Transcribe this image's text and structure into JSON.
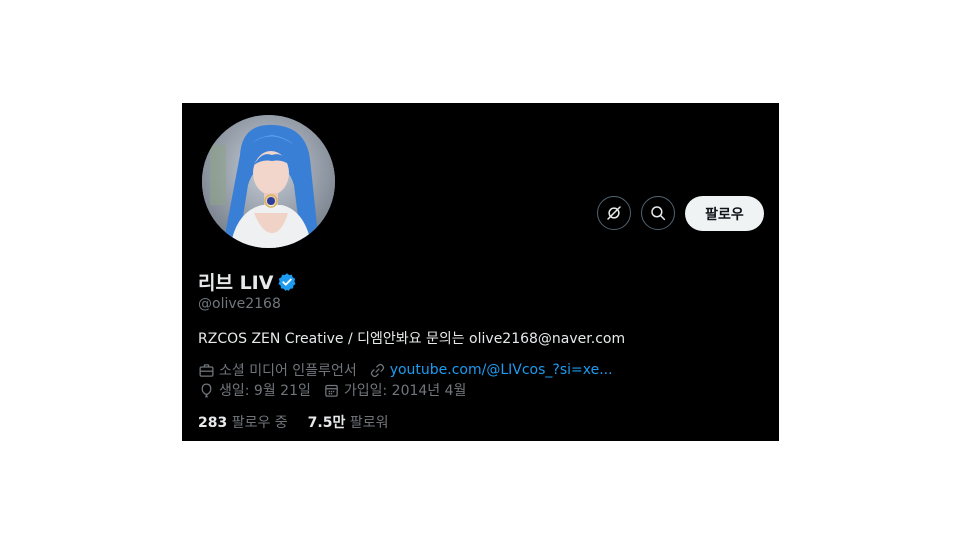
{
  "profile": {
    "name": "리브 LIV",
    "handle": "@olive2168",
    "bio": "RZCOS ZEN Creative / 디엠안봐요 문의는 olive2168@naver.com",
    "category": "소셜 미디어 인플루언서",
    "link": "youtube.com/@LIVcos_?si=xe...",
    "birthday": "생일: 9월 21일",
    "joined": "가입일: 2014년 4월",
    "following_count": "283",
    "following_label": "팔로우 중",
    "followers_count": "7.5만",
    "followers_label": "팔로워"
  },
  "actions": {
    "follow_label": "팔로우"
  },
  "icons": {
    "grok": "grok-icon",
    "search": "search-icon",
    "verified": "verified-badge-icon",
    "category": "briefcase-icon",
    "link": "link-icon",
    "birthday": "balloon-icon",
    "joined": "calendar-icon"
  },
  "colors": {
    "background": "#000000",
    "text": "#e7e9ea",
    "muted": "#71767b",
    "accent": "#1d9bf0",
    "follow_button_bg": "#eff3f4"
  }
}
